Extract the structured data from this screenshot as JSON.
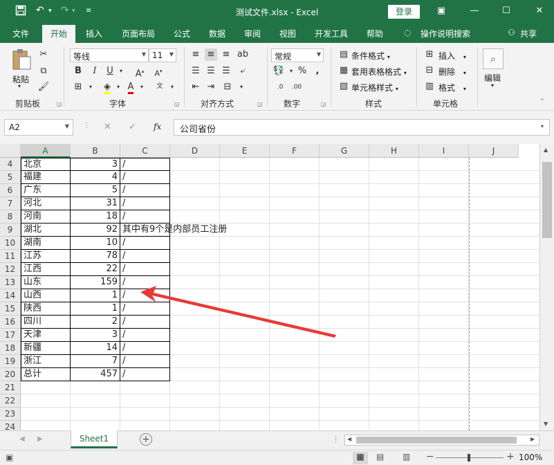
{
  "window": {
    "title": "测试文件.xlsx  -  Excel",
    "login": "登录"
  },
  "tabs": [
    "文件",
    "开始",
    "插入",
    "页面布局",
    "公式",
    "数据",
    "审阅",
    "视图",
    "开发工具",
    "帮助"
  ],
  "tell_me": "操作说明搜索",
  "share": "共享",
  "ribbon": {
    "clipboard": {
      "paste": "粘贴",
      "label": "剪贴板"
    },
    "font": {
      "name": "等线",
      "size": "11",
      "label": "字体",
      "bold": "B",
      "italic": "I",
      "underline": "U"
    },
    "alignment": {
      "label": "对齐方式"
    },
    "number": {
      "format": "常规",
      "label": "数字",
      "percent": "%",
      "comma": ","
    },
    "styles": {
      "cond": "条件格式",
      "table": "套用表格格式",
      "cell": "单元格样式",
      "label": "样式"
    },
    "cells": {
      "insert": "插入",
      "delete": "删除",
      "format": "格式",
      "label": "单元格"
    },
    "editing": {
      "label": "编辑"
    }
  },
  "formula": {
    "namebox": "A2",
    "content": "公司省份",
    "fx": "fx",
    "cancel": "✕",
    "enter": "✓"
  },
  "columns": [
    "A",
    "B",
    "C",
    "D",
    "E",
    "F",
    "G",
    "H",
    "I",
    "J"
  ],
  "rows": [
    {
      "n": "4",
      "a": "北京",
      "b": "3",
      "c": "/"
    },
    {
      "n": "5",
      "a": "福建",
      "b": "4",
      "c": "/"
    },
    {
      "n": "6",
      "a": "广东",
      "b": "5",
      "c": "/"
    },
    {
      "n": "7",
      "a": "河北",
      "b": "31",
      "c": "/"
    },
    {
      "n": "8",
      "a": "河南",
      "b": "18",
      "c": "/"
    },
    {
      "n": "9",
      "a": "湖北",
      "b": "92",
      "c": "其中有9个是内部员工注册"
    },
    {
      "n": "10",
      "a": "湖南",
      "b": "10",
      "c": "/"
    },
    {
      "n": "11",
      "a": "江苏",
      "b": "78",
      "c": "/"
    },
    {
      "n": "12",
      "a": "江西",
      "b": "22",
      "c": "/"
    },
    {
      "n": "13",
      "a": "山东",
      "b": "159",
      "c": "/"
    },
    {
      "n": "14",
      "a": "山西",
      "b": "1",
      "c": "/"
    },
    {
      "n": "15",
      "a": "陕西",
      "b": "1",
      "c": "/"
    },
    {
      "n": "16",
      "a": "四川",
      "b": "2",
      "c": "/"
    },
    {
      "n": "17",
      "a": "天津",
      "b": "3",
      "c": "/"
    },
    {
      "n": "18",
      "a": "新疆",
      "b": "14",
      "c": "/"
    },
    {
      "n": "19",
      "a": "浙江",
      "b": "7",
      "c": "/"
    },
    {
      "n": "20",
      "a": "总计",
      "b": "457",
      "c": "/"
    },
    {
      "n": "21",
      "a": "",
      "b": "",
      "c": ""
    },
    {
      "n": "22",
      "a": "",
      "b": "",
      "c": ""
    },
    {
      "n": "23",
      "a": "",
      "b": "",
      "c": ""
    },
    {
      "n": "24",
      "a": "",
      "b": "",
      "c": ""
    }
  ],
  "sheet": {
    "name": "Sheet1"
  },
  "status": {
    "zoom": "100%"
  },
  "colors": {
    "accent": "#217346",
    "arrow": "#e83a36"
  }
}
